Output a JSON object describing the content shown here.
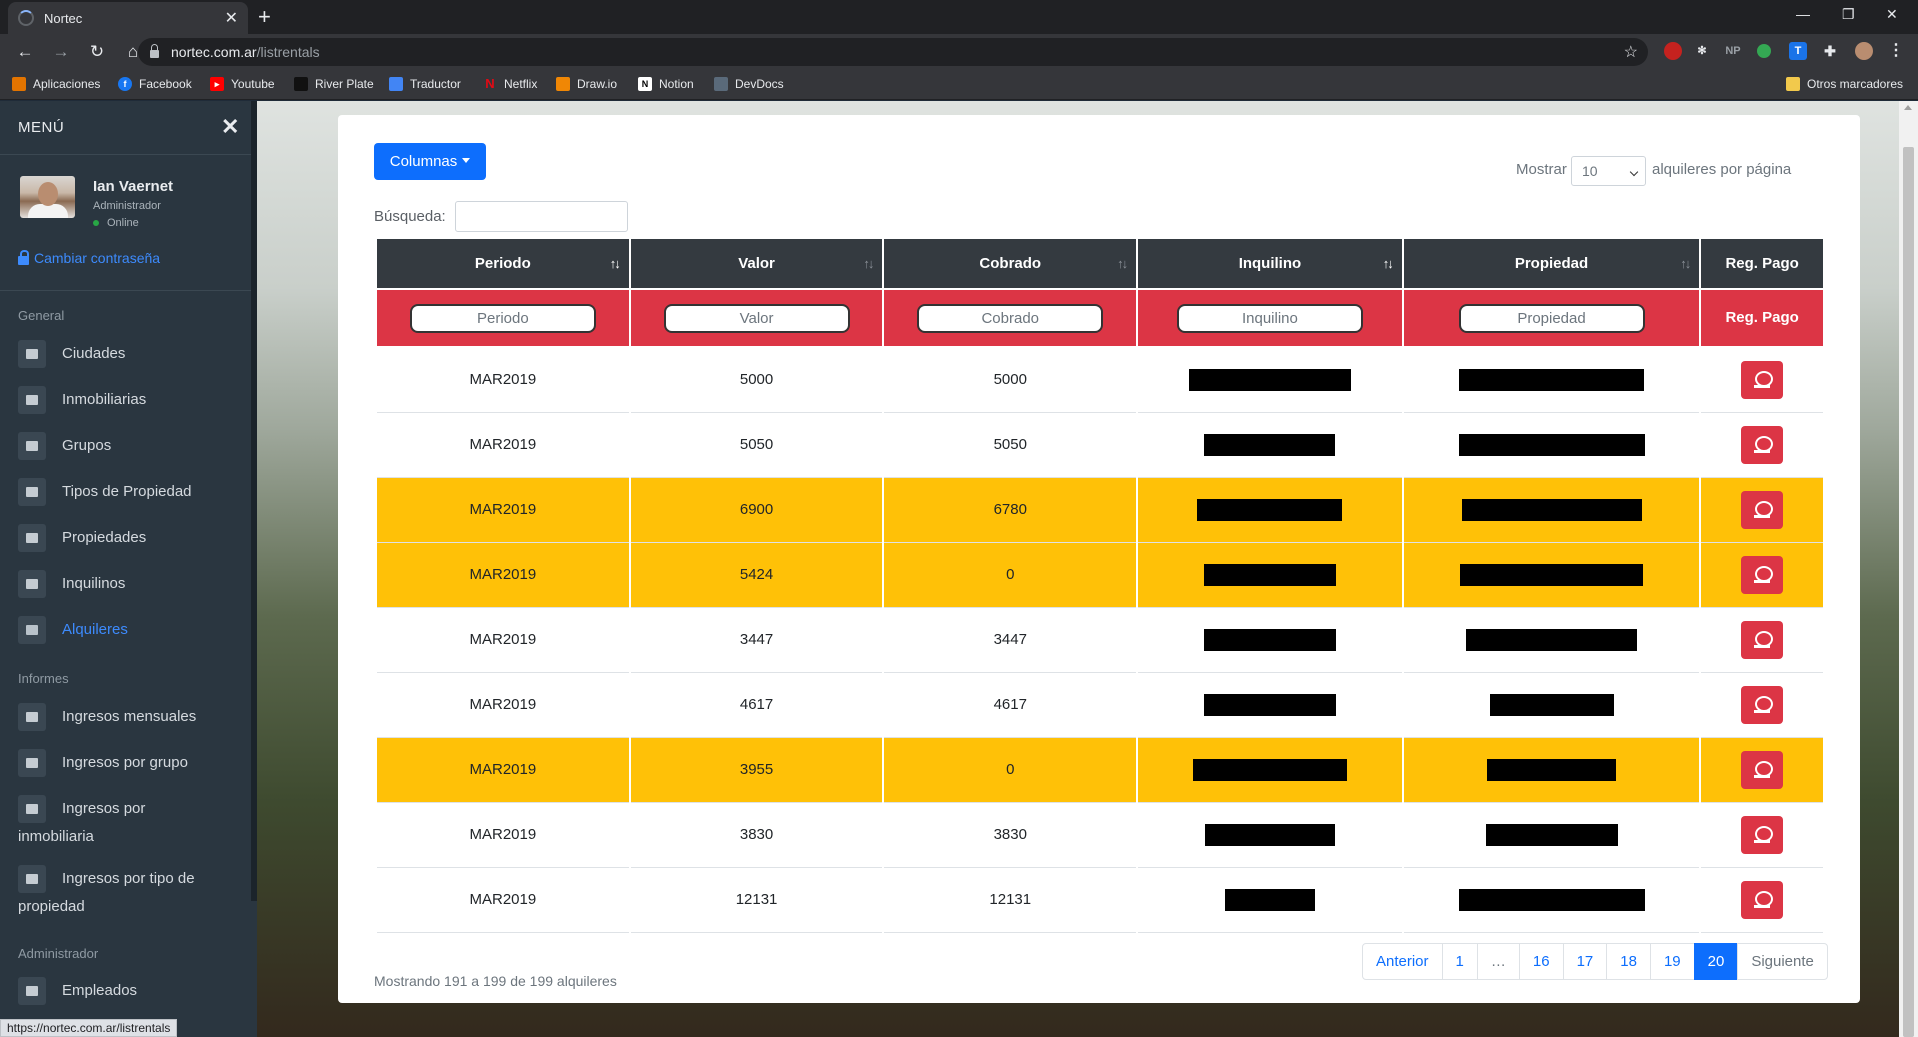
{
  "browser": {
    "tab_title": "Nortec",
    "url_host": "nortec.com.ar",
    "url_path": "/listrentals",
    "status_url": "https://nortec.com.ar/listrentals",
    "bookmarks": [
      "Aplicaciones",
      "Facebook",
      "Youtube",
      "River Plate",
      "Traductor",
      "Netflix",
      "Draw.io",
      "Notion",
      "DevDocs"
    ],
    "other_bookmarks": "Otros marcadores",
    "extensions": {
      "np_label": "NP",
      "t_label": "T"
    }
  },
  "sidebar": {
    "title": "MENÚ",
    "user": {
      "name": "Ian Vaernet",
      "role": "Administrador",
      "status": "Online"
    },
    "change_password": "Cambiar contraseña",
    "sections": {
      "general": {
        "label": "General",
        "items": [
          "Ciudades",
          "Inmobiliarias",
          "Grupos",
          "Tipos de Propiedad",
          "Propiedades",
          "Inquilinos",
          "Alquileres"
        ]
      },
      "informes": {
        "label": "Informes",
        "items": [
          "Ingresos mensuales",
          "Ingresos por grupo",
          "Ingresos por inmobiliaria",
          "Ingresos por tipo de propiedad"
        ]
      },
      "admin": {
        "label": "Administrador",
        "items": [
          "Empleados"
        ]
      }
    },
    "active_item": "Alquileres",
    "accent_color": "#3d8bfd"
  },
  "toolbar": {
    "columns_button": "Columnas",
    "search_label": "Búsqueda:",
    "show_prefix": "Mostrar",
    "show_value": "10",
    "show_suffix": "alquileres por página"
  },
  "table": {
    "headers": [
      "Periodo",
      "Valor",
      "Cobrado",
      "Inquilino",
      "Propiedad",
      "Reg. Pago"
    ],
    "filter_placeholders": [
      "Periodo",
      "Valor",
      "Cobrado",
      "Inquilino",
      "Propiedad"
    ],
    "filter_last_label": "Reg. Pago",
    "rows": [
      {
        "periodo": "MAR2019",
        "valor": "5000",
        "cobrado": "5000",
        "warn": false
      },
      {
        "periodo": "MAR2019",
        "valor": "5050",
        "cobrado": "5050",
        "warn": false
      },
      {
        "periodo": "MAR2019",
        "valor": "6900",
        "cobrado": "6780",
        "warn": true
      },
      {
        "periodo": "MAR2019",
        "valor": "5424",
        "cobrado": "0",
        "warn": true
      },
      {
        "periodo": "MAR2019",
        "valor": "3447",
        "cobrado": "3447",
        "warn": false
      },
      {
        "periodo": "MAR2019",
        "valor": "4617",
        "cobrado": "4617",
        "warn": false
      },
      {
        "periodo": "MAR2019",
        "valor": "3955",
        "cobrado": "0",
        "warn": true
      },
      {
        "periodo": "MAR2019",
        "valor": "3830",
        "cobrado": "3830",
        "warn": false
      },
      {
        "periodo": "MAR2019",
        "valor": "12131",
        "cobrado": "12131",
        "warn": false
      }
    ],
    "colors": {
      "header_bg": "#343a40",
      "filter_bg": "#dc3545",
      "warn_bg": "#ffc107"
    }
  },
  "footer": {
    "info": "Mostrando 191 a 199 de 199 alquileres",
    "pagination": [
      "Anterior",
      "1",
      "…",
      "16",
      "17",
      "18",
      "19",
      "20",
      "Siguiente"
    ],
    "active_page": "20"
  }
}
